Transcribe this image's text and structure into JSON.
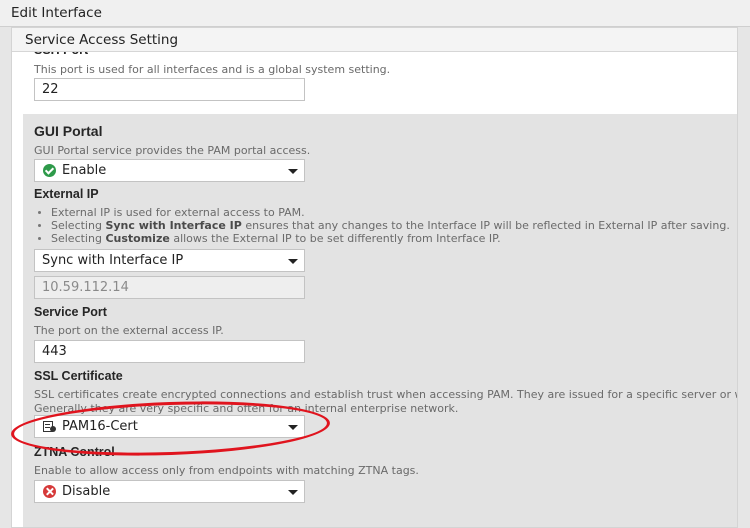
{
  "window": {
    "title": "Edit Interface"
  },
  "section": {
    "title": "Service Access Setting"
  },
  "ssh_port": {
    "label_fragment": "SSH Port",
    "help": "This port is used for all interfaces and is a global system setting.",
    "value": "22"
  },
  "gui_portal": {
    "label": "GUI Portal",
    "help": "GUI Portal service provides the PAM portal access.",
    "value": "Enable",
    "icon": "check-circle-icon",
    "icon_color": "#2e9a4a"
  },
  "external_ip": {
    "label": "External IP",
    "bullets": [
      {
        "pre": "External IP is used for external access to PAM.",
        "bold": "",
        "post": ""
      },
      {
        "pre": "Selecting ",
        "bold": "Sync with Interface IP",
        "post": " ensures that any changes to the Interface IP will be reflected in External IP after saving."
      },
      {
        "pre": "Selecting ",
        "bold": "Customize",
        "post": " allows the External IP to be set differently from Interface IP."
      }
    ],
    "mode": "Sync with Interface IP",
    "ip_value": "10.59.112.14"
  },
  "service_port": {
    "label": "Service Port",
    "help": "The port on the external access IP.",
    "value": "443"
  },
  "ssl_certificate": {
    "label": "SSL Certificate",
    "help_line1": "SSL certificates create encrypted connections and establish trust when accessing PAM. They are issued for a specific server or web site.",
    "help_line2": "Generally they are very specific and often for an internal enterprise network.",
    "value": "PAM16-Cert",
    "icon": "certificate-icon"
  },
  "ztna_control": {
    "label": "ZTNA Control",
    "help": "Enable to allow access only from endpoints with matching ZTNA tags.",
    "value": "Disable",
    "icon": "x-circle-icon",
    "icon_color": "#d63a3a"
  },
  "annotation": {
    "color": "#e0141e"
  }
}
